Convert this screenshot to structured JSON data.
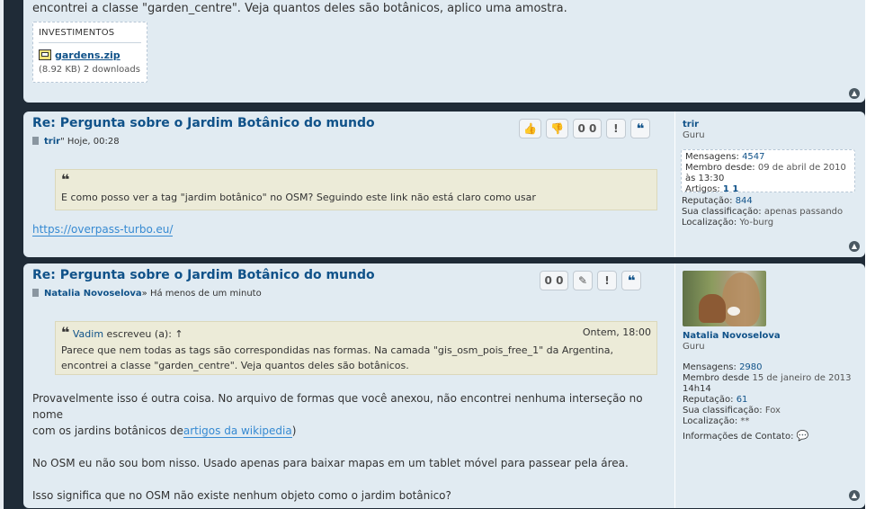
{
  "post1": {
    "text": "encontrei a classe \"garden_centre\". Veja quantos deles são botânicos, aplico uma amostra.",
    "attachment": {
      "heading": "INVESTIMENTOS",
      "file_name": "gardens.zip",
      "meta": "(8.92 KB) 2 downloads"
    }
  },
  "post2": {
    "title": "Re: Pergunta sobre o Jardim Botânico do mundo",
    "author": "trir",
    "author_suffix": "\"",
    "time": " Hoje, 00:28",
    "reaction_count": "0 0",
    "quote_text": "E como posso ver a tag \"jardim botânico\" no OSM? Seguindo este link não está claro como usar",
    "link": "https://overpass-turbo.eu/",
    "profile": {
      "username": "trir",
      "rank": "Guru",
      "messages_label": "Mensagens: ",
      "messages": "4547",
      "member_label": "Membro desde: ",
      "member_since": "09 de abril de 2010",
      "member_time": "às 13:30",
      "articles_label": "Artigos: ",
      "articles": "1 1",
      "reputation_label": "Reputação: ",
      "reputation": "844",
      "classification_label": "Sua classificação: ",
      "classification": "apenas passando",
      "location_label": "Localização: ",
      "location": "Yo-burg"
    }
  },
  "post3": {
    "title": "Re: Pergunta sobre o Jardim Botânico do mundo",
    "author": "Natalia Novoselova",
    "time": "» Há menos de um minuto",
    "reaction_count": "0 0",
    "quote_author": "Vadim",
    "quote_wrote": " escreveu (a): ↑",
    "quote_time": "Ontem, 18:00",
    "quote_line1": "Parece que nem todas as tags são correspondidas nas formas. Na camada \"gis_osm_pois_free_1\" da Argentina,",
    "quote_line2": "encontrei a classe \"garden_centre\". Veja quantos deles são botânicos.",
    "para1_a": "Provavelmente isso é outra coisa. No arquivo de formas que você anexou, não encontrei nenhuma interseção no nome",
    "para1_b": "com os jardins botânicos de",
    "para1_link": "artigos da wikipedia",
    "para1_c": ")",
    "para2": "No OSM eu não sou bom nisso. Usado apenas para baixar mapas em um tablet móvel para passear pela área.",
    "para3": "Isso significa que no OSM não existe nenhum objeto como o jardim botânico?",
    "profile": {
      "username": "Natalia Novoselova",
      "rank": "Guru",
      "messages_label": "Mensagens: ",
      "messages": "2980",
      "member_label": "Membro desde ",
      "member_since": "15 de janeiro de 2013",
      "member_time": "14h14",
      "reputation_label": "Reputação: ",
      "reputation": "61",
      "classification_label": "Sua classificação: ",
      "classification": "Fox",
      "location_label": "Localização: ",
      "location": "**",
      "contact_label": "Informações de Contato: "
    }
  },
  "icons": {
    "thumbs_up": "👍",
    "thumbs_down": "👎",
    "report": "!",
    "quote": "❝",
    "edit": "✎",
    "top": "▲",
    "chat": "💬"
  }
}
